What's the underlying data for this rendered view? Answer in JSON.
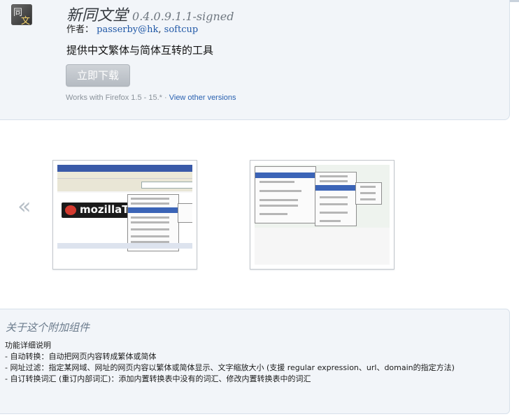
{
  "addon": {
    "name": "新同文堂",
    "version": "0.4.0.9.1.1-signed",
    "author_label": "作者：",
    "authors": [
      "passerby@hk",
      "softcup"
    ],
    "author_separator": ", ",
    "summary": "提供中文繁体与简体互转的工具",
    "install_label": "立即下载",
    "compat_text": "Works with Firefox 1.5 - 15.* · ",
    "other_versions_link": "View other versions",
    "icon_glyphs": [
      "同",
      "文"
    ]
  },
  "gallery": {
    "prev_arrow": "«",
    "screenshots": [
      {
        "logo_text": "mozillaTa"
      },
      {}
    ]
  },
  "about": {
    "heading": "关于这个附加组件",
    "lines": [
      "功能详细说明",
      "- 自动转换：自动把网页内容转成繁体或简体",
      "- 网址过滤：指定某网域、网址的网页内容以繁体或简体显示、文字缩放大小 (支援 regular expression、url、domain的指定方法)",
      "- 自订转换词汇 (重订内部词汇)：添加内置转换表中没有的词汇、修改内置转换表中的词汇"
    ]
  },
  "colors": {
    "link": "#1f57a6",
    "card_bg": "#f2f5f9",
    "card_border": "#d7e0ea",
    "install_disabled": "#b5bbc2",
    "heading": "#6b7b8c"
  }
}
